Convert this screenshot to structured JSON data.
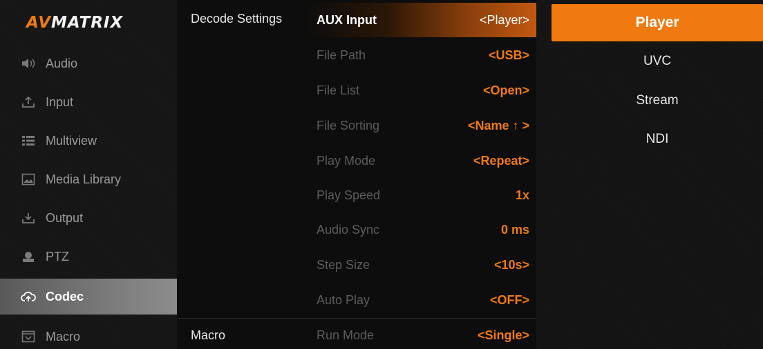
{
  "brand": {
    "logo_a": "AV",
    "logo_b": "MATRIX"
  },
  "sidebar": {
    "items": [
      {
        "label": "Audio",
        "icon": "speaker-icon"
      },
      {
        "label": "Input",
        "icon": "upload-icon"
      },
      {
        "label": "Multiview",
        "icon": "list-icon"
      },
      {
        "label": "Media Library",
        "icon": "image-icon"
      },
      {
        "label": "Output",
        "icon": "download-icon"
      },
      {
        "label": "PTZ",
        "icon": "camera-icon"
      },
      {
        "label": "Codec",
        "icon": "cloud-sync-icon",
        "active": true
      },
      {
        "label": "Macro",
        "icon": "macro-icon"
      }
    ]
  },
  "middle": {
    "groups": {
      "decode": "Decode Settings",
      "macro": "Macro"
    },
    "rows": [
      {
        "label": "AUX Input",
        "value": "<Player>"
      },
      {
        "label": "File Path",
        "value": "<USB>"
      },
      {
        "label": "File List",
        "value": "<Open>"
      },
      {
        "label": "File Sorting",
        "value": "<Name ↑ >"
      },
      {
        "label": "Play Mode",
        "value": "<Repeat>"
      },
      {
        "label": "Play Speed",
        "value": "1x"
      },
      {
        "label": "Audio Sync",
        "value": "0 ms"
      },
      {
        "label": "Step Size",
        "value": "<10s>"
      },
      {
        "label": "Auto Play",
        "value": "<OFF>"
      },
      {
        "label": "Run Mode",
        "value": "<Single>"
      }
    ]
  },
  "options": {
    "items": [
      "Player",
      "UVC",
      "Stream",
      "NDI"
    ],
    "selected": "Player"
  },
  "colors": {
    "accent": "#f07a10",
    "muted_label": "#5c5c5c",
    "sidebar_text": "#9a9a9a"
  }
}
